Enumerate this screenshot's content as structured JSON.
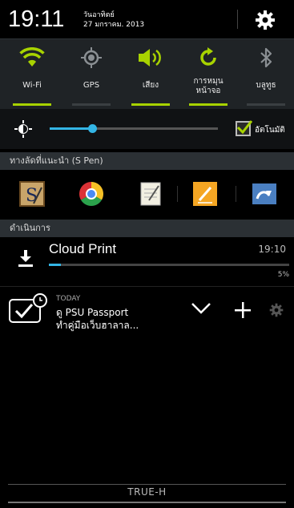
{
  "status": {
    "time": "19:11",
    "day": "วันอาทิตย์",
    "date": "27 มกราคม. 2013"
  },
  "toggles": [
    {
      "label": "Wi-Fi",
      "icon": "wifi-icon",
      "on": true
    },
    {
      "label": "GPS",
      "icon": "gps-icon",
      "on": false
    },
    {
      "label": "เสียง",
      "icon": "sound-icon",
      "on": true
    },
    {
      "label_line1": "การหมุน",
      "label_line2": "หน้าจอ",
      "icon": "rotate-icon",
      "on": true
    },
    {
      "label": "บลูทูธ",
      "icon": "bluetooth-icon",
      "on": false
    }
  ],
  "brightness": {
    "level": 0.25,
    "auto_label": "อัตโนมัติ",
    "auto_checked": true
  },
  "shortcuts": {
    "header": "ทางลัดที่แนะนำ (S Pen)",
    "items": [
      "s-note-icon",
      "chrome-icon",
      "memo-icon",
      "pen-memo-icon",
      "idea-sketch-icon"
    ]
  },
  "ongoing": {
    "header": "ดำเนินการ",
    "title": "Cloud Print",
    "time": "19:10",
    "progress_text": "5%",
    "progress": 0.05
  },
  "reminder": {
    "today": "TODAY",
    "line1": "ดู PSU Passport",
    "line2": "ทำคู่มือเว็บฮาลาล..."
  },
  "footer": {
    "carrier": "TRUE-H"
  },
  "colors": {
    "accent_green": "#a8d300",
    "accent_blue": "#33b5e5"
  }
}
